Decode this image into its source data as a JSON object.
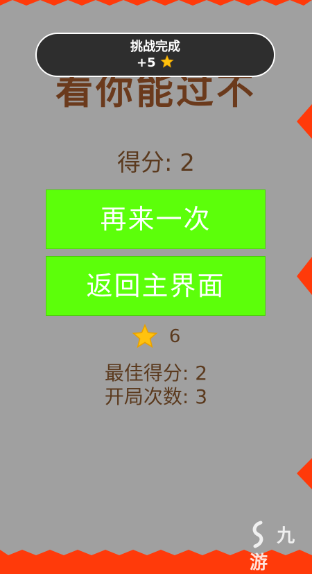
{
  "game": {
    "title_partial": "看你能过不",
    "toast": {
      "title": "挑战完成",
      "reward": "+5"
    },
    "score_text": "得分: 2",
    "buttons": {
      "retry": "再来一次",
      "home": "返回主界面"
    },
    "stars_count": "6",
    "best_score_text": "最佳得分: 2",
    "games_played_text": "开局次数: 3"
  },
  "watermark": {
    "text": "九游"
  },
  "colors": {
    "frame": "#ff3a0a",
    "panel": "#a0a0a0",
    "button": "#5cff0a",
    "text_brown": "#5b3a1e",
    "toast_bg": "#2e2e2e",
    "star": "#ffc20e"
  }
}
